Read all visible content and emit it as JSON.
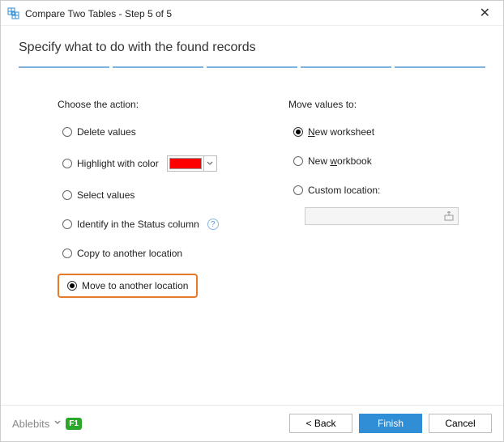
{
  "window": {
    "title": "Compare Two Tables - Step 5 of 5"
  },
  "heading": "Specify what to do with the found records",
  "leftColumn": {
    "label": "Choose the action:",
    "delete": "Delete values",
    "highlight": "Highlight with color",
    "select": "Select values",
    "identify": "Identify in the Status column",
    "copy": "Copy to another location",
    "move": "Move to another location"
  },
  "rightColumn": {
    "label": "Move values to:",
    "newWorksheet_prefix": "N",
    "newWorksheet_rest": "ew worksheet",
    "newWorkbook_prefix": "New ",
    "newWorkbook_underlined": "w",
    "newWorkbook_suffix": "orkbook",
    "custom": "Custom location:",
    "customValue": ""
  },
  "helpChar": "?",
  "colorSwatchHex": "#ff0000",
  "footer": {
    "brand": "Ablebits",
    "f1": "F1",
    "back": "< Back",
    "finish": "Finish",
    "cancel": "Cancel"
  }
}
